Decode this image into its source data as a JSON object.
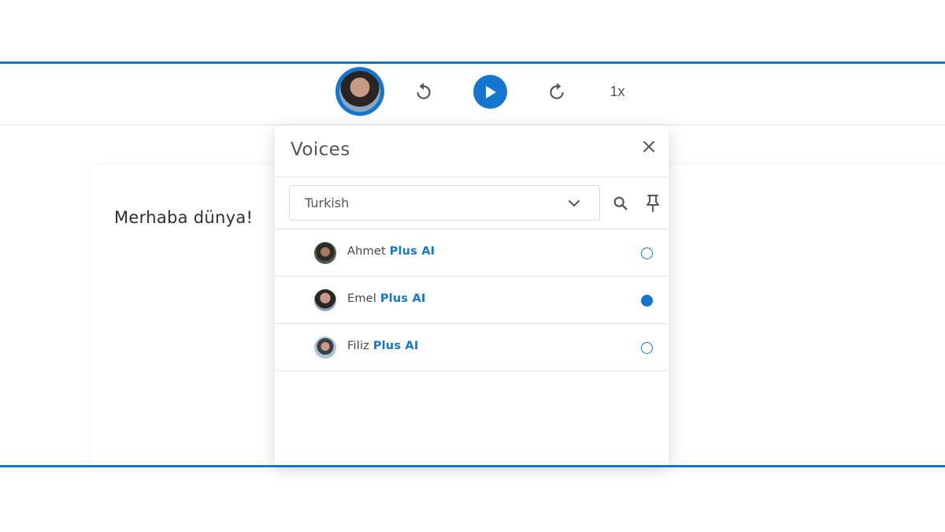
{
  "player": {
    "speed_label": "1x",
    "current_voice": "Emel"
  },
  "card": {
    "text": "Merhaba dünya!"
  },
  "voices_panel": {
    "title": "Voices",
    "language": {
      "selected": "Turkish"
    },
    "voices": [
      {
        "name": "Ahmet",
        "tier": "Plus AI",
        "selected": false
      },
      {
        "name": "Emel",
        "tier": "Plus AI",
        "selected": true
      },
      {
        "name": "Filiz",
        "tier": "Plus AI",
        "selected": false
      }
    ]
  },
  "colors": {
    "accent": "#1576cf",
    "text": "#444444",
    "border": "#e4e4e4"
  },
  "icons": [
    "rewind-icon",
    "play-icon",
    "forward-icon",
    "close-icon",
    "chevron-down-icon",
    "search-icon",
    "pin-icon"
  ]
}
